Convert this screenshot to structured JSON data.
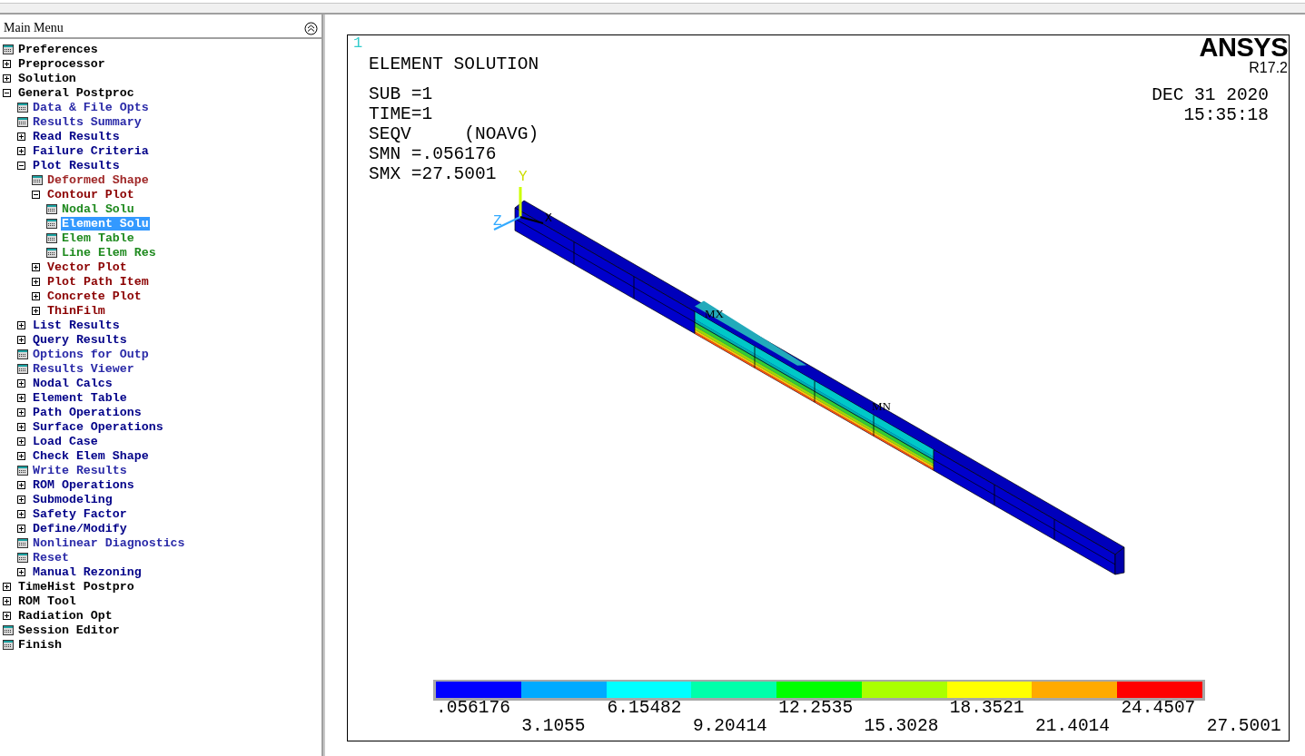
{
  "menu": {
    "title": "Main Menu",
    "items": [
      {
        "label": "Preferences",
        "kind": "dialog",
        "selected": false
      },
      {
        "label": "Preprocessor",
        "kind": "folder",
        "expanded": false,
        "selected": false
      },
      {
        "label": "Solution",
        "kind": "folder",
        "expanded": false,
        "selected": false
      },
      {
        "label": "General Postproc",
        "kind": "folder",
        "expanded": true,
        "selected": false,
        "children": [
          {
            "label": "Data & File Opts",
            "kind": "dialog",
            "selected": false
          },
          {
            "label": "Results Summary",
            "kind": "dialog",
            "selected": false
          },
          {
            "label": "Read Results",
            "kind": "folder",
            "expanded": false,
            "selected": false
          },
          {
            "label": "Failure Criteria",
            "kind": "folder",
            "expanded": false,
            "selected": false
          },
          {
            "label": "Plot Results",
            "kind": "folder",
            "expanded": true,
            "selected": false,
            "children": [
              {
                "label": "Deformed Shape",
                "kind": "dialog",
                "selected": false
              },
              {
                "label": "Contour Plot",
                "kind": "folder",
                "expanded": true,
                "selected": false,
                "children": [
                  {
                    "label": "Nodal Solu",
                    "kind": "dialog",
                    "selected": false
                  },
                  {
                    "label": "Element Solu",
                    "kind": "dialog",
                    "selected": true
                  },
                  {
                    "label": "Elem Table",
                    "kind": "dialog",
                    "selected": false
                  },
                  {
                    "label": "Line Elem Res",
                    "kind": "dialog",
                    "selected": false
                  }
                ]
              },
              {
                "label": "Vector Plot",
                "kind": "folder",
                "expanded": false,
                "selected": false
              },
              {
                "label": "Plot Path Item",
                "kind": "folder",
                "expanded": false,
                "selected": false
              },
              {
                "label": "Concrete Plot",
                "kind": "folder",
                "expanded": false,
                "selected": false
              },
              {
                "label": "ThinFilm",
                "kind": "folder",
                "expanded": false,
                "selected": false
              }
            ]
          },
          {
            "label": "List Results",
            "kind": "folder",
            "expanded": false,
            "selected": false
          },
          {
            "label": "Query Results",
            "kind": "folder",
            "expanded": false,
            "selected": false
          },
          {
            "label": "Options for Outp",
            "kind": "dialog",
            "selected": false
          },
          {
            "label": "Results Viewer",
            "kind": "dialog",
            "selected": false
          },
          {
            "label": "Nodal Calcs",
            "kind": "folder",
            "expanded": false,
            "selected": false
          },
          {
            "label": "Element Table",
            "kind": "folder",
            "expanded": false,
            "selected": false
          },
          {
            "label": "Path Operations",
            "kind": "folder",
            "expanded": false,
            "selected": false
          },
          {
            "label": "Surface Operations",
            "kind": "folder",
            "expanded": false,
            "selected": false
          },
          {
            "label": "Load Case",
            "kind": "folder",
            "expanded": false,
            "selected": false
          },
          {
            "label": "Check Elem Shape",
            "kind": "folder",
            "expanded": false,
            "selected": false
          },
          {
            "label": "Write Results",
            "kind": "dialog",
            "selected": false
          },
          {
            "label": "ROM Operations",
            "kind": "folder",
            "expanded": false,
            "selected": false
          },
          {
            "label": "Submodeling",
            "kind": "folder",
            "expanded": false,
            "selected": false
          },
          {
            "label": "Safety Factor",
            "kind": "folder",
            "expanded": false,
            "selected": false
          },
          {
            "label": "Define/Modify",
            "kind": "folder",
            "expanded": false,
            "selected": false
          },
          {
            "label": "Nonlinear Diagnostics",
            "kind": "dialog",
            "selected": false
          },
          {
            "label": "Reset",
            "kind": "dialog",
            "selected": false
          },
          {
            "label": "Manual Rezoning",
            "kind": "folder",
            "expanded": false,
            "selected": false
          }
        ]
      },
      {
        "label": "TimeHist Postpro",
        "kind": "folder",
        "expanded": false,
        "selected": false
      },
      {
        "label": "ROM Tool",
        "kind": "folder",
        "expanded": false,
        "selected": false
      },
      {
        "label": "Radiation Opt",
        "kind": "folder",
        "expanded": false,
        "selected": false
      },
      {
        "label": "Session Editor",
        "kind": "dialog",
        "selected": false
      },
      {
        "label": "Finish",
        "kind": "dialog",
        "selected": false
      }
    ]
  },
  "graphics": {
    "window_number": "1",
    "title": "ELEMENT SOLUTION",
    "info": [
      "SUB =1",
      "TIME=1",
      "SEQV     (NOAVG)",
      "SMN =.056176",
      "SMX =27.5001"
    ],
    "logo": {
      "name": "ANSYS",
      "version": "R17.2"
    },
    "date": "DEC 31 2020",
    "time": "15:35:18",
    "axes": {
      "y": "Y",
      "z": "Z",
      "x": "X"
    },
    "max_marker": "MX",
    "min_marker": "MN",
    "legend": {
      "segments": [
        {
          "color": "#0000ff"
        },
        {
          "color": "#00aaff"
        },
        {
          "color": "#00ffff"
        },
        {
          "color": "#00ffaa"
        },
        {
          "color": "#00ff00"
        },
        {
          "color": "#aaff00"
        },
        {
          "color": "#ffff00"
        },
        {
          "color": "#ffaa00"
        },
        {
          "color": "#ff0000"
        }
      ],
      "labels": [
        ".056176",
        "3.1055",
        "6.15482",
        "9.20414",
        "12.2535",
        "15.3028",
        "18.3521",
        "21.4014",
        "24.4507",
        "27.5001"
      ]
    }
  }
}
